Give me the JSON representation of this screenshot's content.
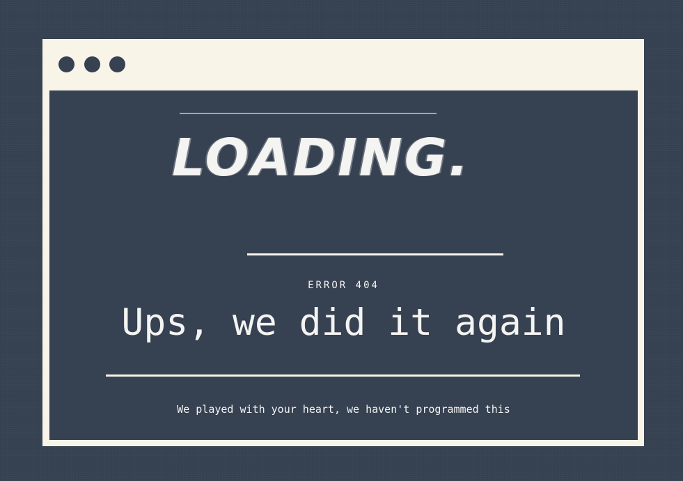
{
  "window": {
    "controls": [
      "dot",
      "dot",
      "dot"
    ]
  },
  "loading": {
    "text": "LOADING."
  },
  "error": {
    "code": "ERROR 404",
    "headline": "Ups, we did it again",
    "message": "We played with your heart, we haven't programmed this"
  },
  "colors": {
    "background": "#364152",
    "frame": "#f8f5e8",
    "text": "#f4f4f2"
  }
}
